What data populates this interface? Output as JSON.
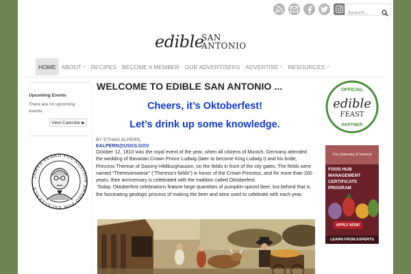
{
  "header": {
    "social_icons": [
      "rss-icon",
      "email-icon",
      "facebook-icon",
      "twitter-icon",
      "instagram-icon"
    ],
    "search": {
      "placeholder": "Search..."
    },
    "logo": {
      "word": "edible",
      "line1": "SAN",
      "line2": "ANTONIO"
    }
  },
  "nav": {
    "items": [
      {
        "label": "HOME",
        "active": true,
        "has_dropdown": false
      },
      {
        "label": "ABOUT",
        "active": false,
        "has_dropdown": true
      },
      {
        "label": "RECIPES",
        "active": false,
        "has_dropdown": false
      },
      {
        "label": "BECOME A MEMBER",
        "active": false,
        "has_dropdown": false
      },
      {
        "label": "OUR ADVERTISERS",
        "active": false,
        "has_dropdown": false
      },
      {
        "label": "ADVERTISE",
        "active": false,
        "has_dropdown": true
      },
      {
        "label": "RESOURCES",
        "active": false,
        "has_dropdown": true
      }
    ]
  },
  "left_sidebar": {
    "events_title": "Upcoming Events",
    "events_empty": "There are no upcoming events.",
    "view_calendar": "View Calendar",
    "award_text": "JAMES BEARD FOUNDATION AWARD FOR EXCELLENCE"
  },
  "main": {
    "page_title": "WELCOME TO EDIBLE SAN ANTONIO ...",
    "headline1": "Cheers, it’s Oktoberfest!",
    "headline2": "Let’s drink up some knowledge.",
    "byline": "BY ETHAN ALPERN,",
    "email": "EALPERN@USGS.GOV",
    "paragraph1": "October 12, 1810 was the royal event of the year, when all citizens of Munich, Germany attended the wedding of Bavarian Crown Prince Ludwig (later to become King Ludwig I) and his bride, Princess Therese of Saxony-Hildburghausen, on the fields in front of the city gates. The fields were named “Theresienwiese” (“Theresa’s fields”) in honor of the Crown Princess, and for more than 200 years, their anniversary is celebrated with the tradition called Oktoberfest.",
    "paragraph2": " Today, Oktoberfest celebrations feature large quantities of pumpkin-spiced beer, but behind that is the fascinating geologic process of making the beer and wine used to celebrate with each year."
  },
  "right_sidebar": {
    "badge": {
      "top": "OFFICIAL",
      "word1": "edible",
      "word2": "FEAST",
      "bottom": "PARTNER"
    },
    "ad": {
      "university": "The University of Vermont",
      "headline": "FOOD HUB MANAGEMENT CERTIFICATE PROGRAM",
      "cta": "APPLY NOW!",
      "footer": "LEARN FROM EXPERTS"
    }
  },
  "colors": {
    "background": "#6b8650",
    "headline_blue": "#1038c9",
    "badge_green": "#4a8a3a",
    "ad_maroon": "#6a2028"
  }
}
